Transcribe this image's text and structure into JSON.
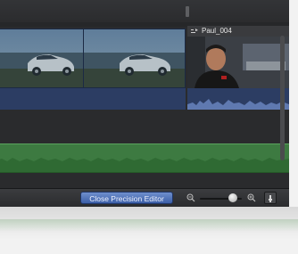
{
  "timeline": {
    "clip_name": "Paul_004"
  },
  "bottom_bar": {
    "close_button_label": "Close Precision Editor",
    "zoom_level": 0.78
  },
  "icons": [
    "zoom-out-icon",
    "zoom-in-icon",
    "clip-appearance-icon",
    "clip-type-icon"
  ]
}
